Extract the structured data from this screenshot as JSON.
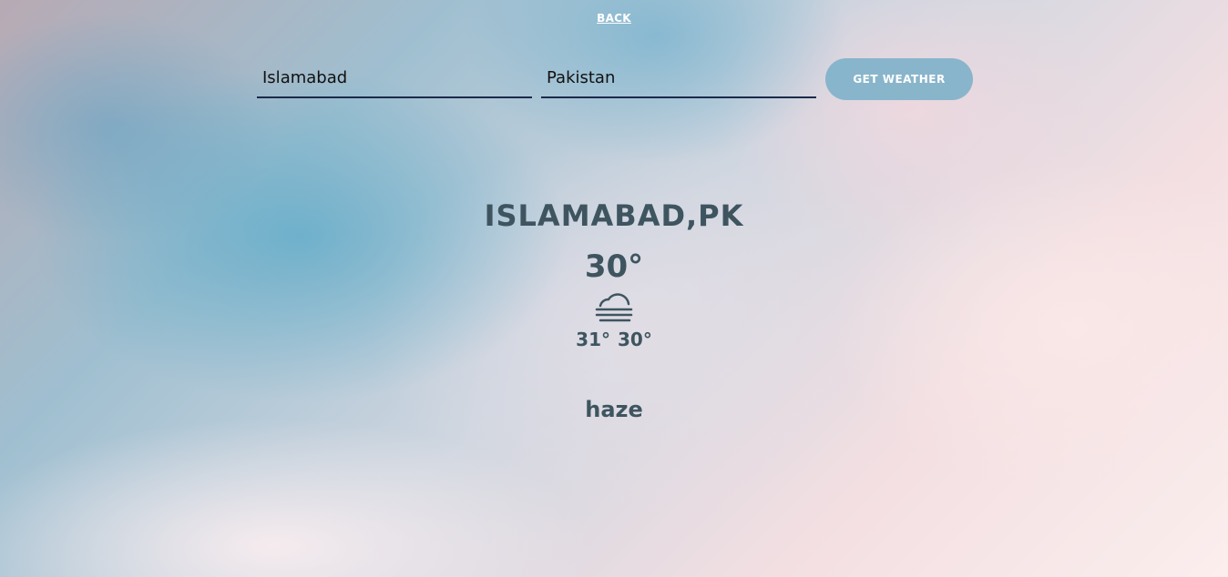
{
  "nav": {
    "back_label": "BACK"
  },
  "search": {
    "city_value": "Islamabad",
    "country_value": "Pakistan",
    "button_label": "GET WEATHER"
  },
  "weather": {
    "location": "ISLAMABAD,PK",
    "temperature": "30°",
    "icon": "fog-icon",
    "temp_max": "31°",
    "temp_min": "30°",
    "description": "haze"
  },
  "colors": {
    "text": "#3e5560",
    "button_bg": "#78afc8",
    "input_underline": "#1b2a4a"
  }
}
